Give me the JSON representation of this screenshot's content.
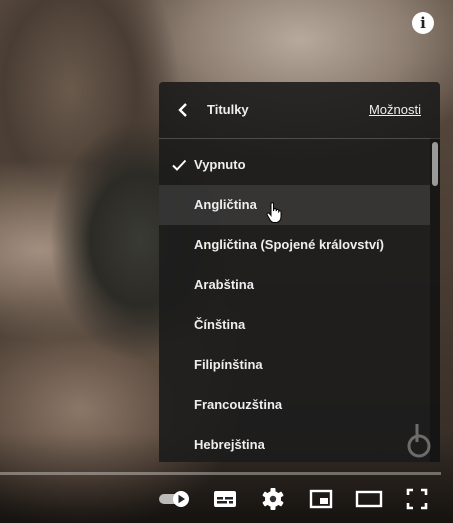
{
  "menu": {
    "title": "Titulky",
    "options_label": "Možnosti",
    "items": [
      {
        "label": "Vypnuto",
        "selected": true
      },
      {
        "label": "Angličtina",
        "hovered": true
      },
      {
        "label": "Angličtina (Spojené království)"
      },
      {
        "label": "Arabština"
      },
      {
        "label": "Čínština"
      },
      {
        "label": "Filipínština"
      },
      {
        "label": "Francouzština"
      },
      {
        "label": "Hebrejština"
      }
    ]
  },
  "icons": {
    "info": "info-icon",
    "back": "chevron-left-icon",
    "check": "checkmark-icon",
    "autoplay": "autoplay-toggle-icon",
    "subtitles": "subtitles-icon",
    "settings": "gear-icon",
    "miniplayer": "miniplayer-icon",
    "theater": "theater-mode-icon",
    "fullscreen": "fullscreen-icon"
  },
  "info_glyph": "i"
}
